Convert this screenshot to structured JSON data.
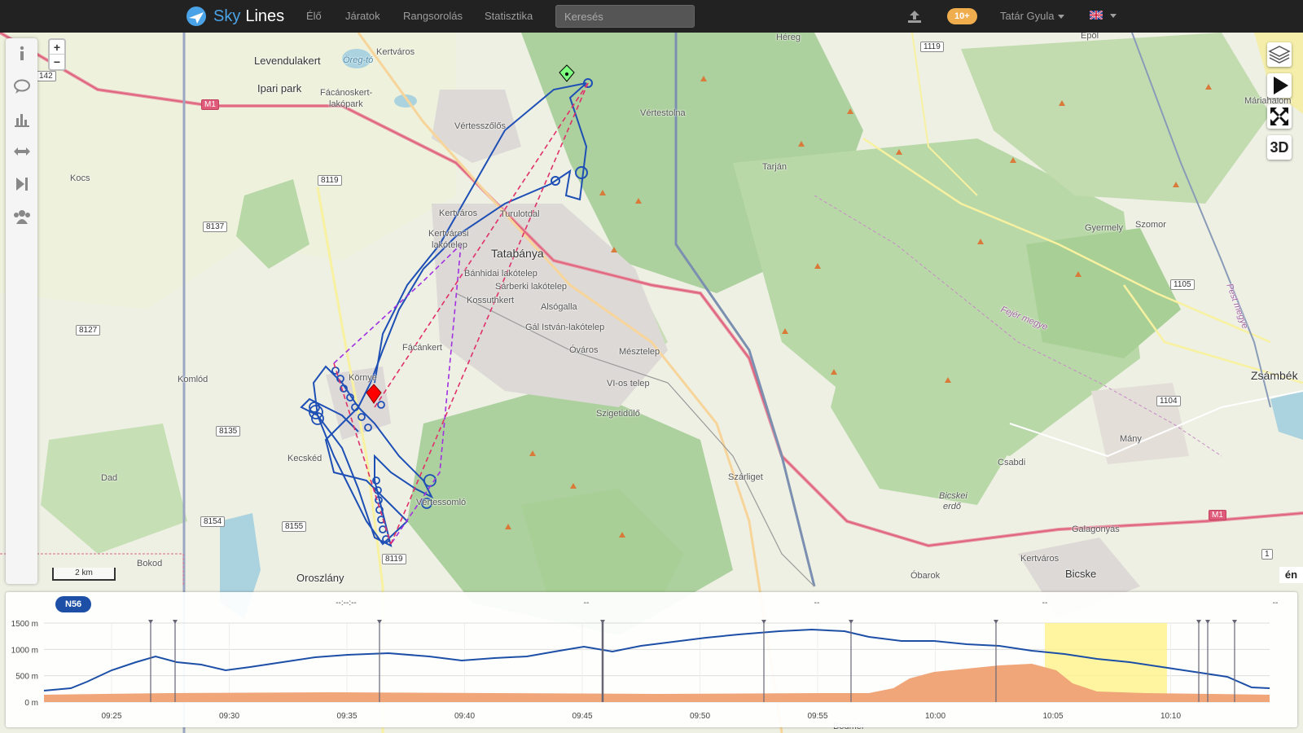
{
  "navbar": {
    "brand_sky": "Sky",
    "brand_lines": "Lines",
    "links": [
      "Élő",
      "Járatok",
      "Rangsorolás",
      "Statisztika"
    ],
    "search_placeholder": "Keresés",
    "notification_badge": "10+",
    "user_name": "Tatár Gyula",
    "language_flag": "uk-flag-icon"
  },
  "sidebar": {
    "icons": [
      "info-icon",
      "comments-icon",
      "chart-icon",
      "measure-icon",
      "skip-forward-icon",
      "group-icon"
    ]
  },
  "map": {
    "zoom_in": "+",
    "zoom_out": "−",
    "scale_label": "2 km",
    "controls": [
      "layers-icon",
      "play-icon",
      "fullscreen-icon"
    ],
    "ctl_3d_label": "3D",
    "attribution": "én",
    "labels": [
      {
        "text": "Levendulakert"
      },
      {
        "text": "Öreg-tó"
      },
      {
        "text": "Kertváros"
      },
      {
        "text": "Ipari park"
      },
      {
        "text": "Fácánoskert-"
      },
      {
        "text": "lakópark"
      },
      {
        "text": "Vértesszőlős"
      },
      {
        "text": "Kocs"
      },
      {
        "text": "Kertváros"
      },
      {
        "text": "Turulotdal"
      },
      {
        "text": "Kertvárosi"
      },
      {
        "text": "lakótelep"
      },
      {
        "text": "Tatabánya"
      },
      {
        "text": "Bánhidai lakótelep"
      },
      {
        "text": "Sárberki lakótelep"
      },
      {
        "text": "Kossuthkert"
      },
      {
        "text": "Alsógalla"
      },
      {
        "text": "Gál István-lakótelep"
      },
      {
        "text": "Fácánkert"
      },
      {
        "text": "Óváros"
      },
      {
        "text": "Mésztelep"
      },
      {
        "text": "Környe"
      },
      {
        "text": "Komlód"
      },
      {
        "text": "VI-os telep"
      },
      {
        "text": "Szigetidűlő"
      },
      {
        "text": "Kecskéd"
      },
      {
        "text": "Dad"
      },
      {
        "text": "Vértessomló"
      },
      {
        "text": "Bokod"
      },
      {
        "text": "Oroszlány"
      },
      {
        "text": "Szárliget"
      },
      {
        "text": "Óbarok"
      },
      {
        "text": "Kertváros"
      },
      {
        "text": "Bicske"
      },
      {
        "text": "Galagonyás"
      },
      {
        "text": "Csabdi"
      },
      {
        "text": "Mány"
      },
      {
        "text": "Bicskei"
      },
      {
        "text": "erdő"
      },
      {
        "text": "Zsámbék"
      },
      {
        "text": "Gyermely"
      },
      {
        "text": "Szomor"
      },
      {
        "text": "Tarján"
      },
      {
        "text": "Vértestolna"
      },
      {
        "text": "Héreg"
      },
      {
        "text": "Epöl"
      },
      {
        "text": "Máriahalom"
      },
      {
        "text": "Fejér megye"
      },
      {
        "text": "Pest megye"
      },
      {
        "text": "Bodmér"
      }
    ],
    "road_numbers": [
      {
        "text": "M1",
        "pink": true
      },
      {
        "text": "142",
        "pink": false
      },
      {
        "text": "8119",
        "pink": false
      },
      {
        "text": "8137",
        "pink": false
      },
      {
        "text": "8127",
        "pink": false
      },
      {
        "text": "8135",
        "pink": false
      },
      {
        "text": "8154",
        "pink": false
      },
      {
        "text": "8155",
        "pink": false
      },
      {
        "text": "8119",
        "pink": false
      },
      {
        "text": "1119",
        "pink": false
      },
      {
        "text": "1105",
        "pink": false
      },
      {
        "text": "1104",
        "pink": false
      },
      {
        "text": "M1",
        "pink": true
      },
      {
        "text": "1",
        "pink": false
      }
    ]
  },
  "barogram": {
    "pill_label": "N56",
    "header_placeholders": [
      "--:--:--",
      "--",
      "--",
      "--",
      "--"
    ],
    "y_ticks": [
      "1500 m",
      "1000 m",
      "500 m",
      "0 m"
    ],
    "x_ticks": [
      "09:25",
      "09:30",
      "09:35",
      "09:40",
      "09:45",
      "09:50",
      "09:55",
      "10:00",
      "10:05",
      "10:10"
    ],
    "colors": {
      "altitude": "#1d4fa6",
      "terrain": "#f0a679",
      "highlight": "#fff28a"
    }
  }
}
